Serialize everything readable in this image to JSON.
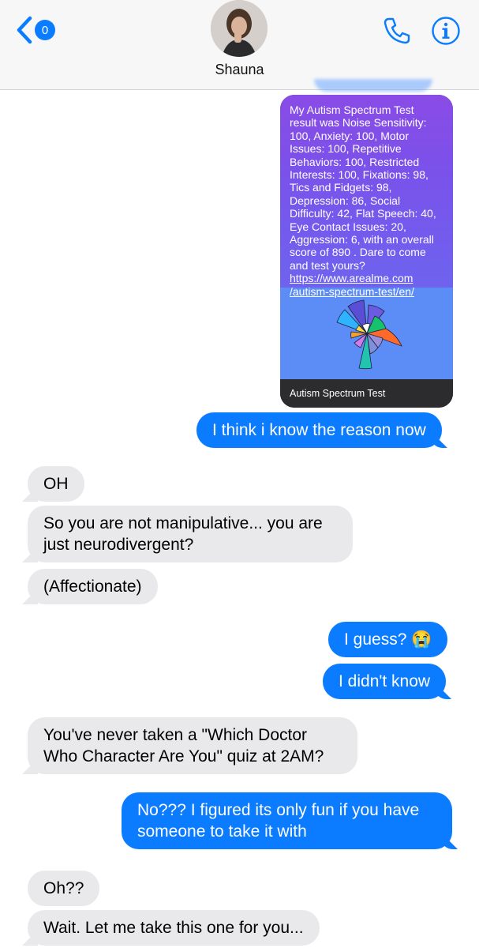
{
  "header": {
    "back_badge": "0",
    "contact_name": "Shauna"
  },
  "card": {
    "body_text": "My Autism Spectrum Test result was Noise Sensitivity: 100, Anxiety: 100, Motor Issues: 100, Repetitive Behaviors: 100, Restricted Interests: 100, Fixations: 98, Tics and Fidgets: 98, Depression: 86, Social Difficulty: 42, Flat Speech: 40, Eye Contact Issues: 20, Aggression: 6, with an overall score of 890 . Dare to come and test yours?",
    "link_line1": "https://www.arealme.com",
    "link_line2": "/autism-spectrum-test/en/",
    "caption": "Autism Spectrum Test"
  },
  "messages": [
    {
      "from": "me",
      "text": "I think i know the reason now"
    },
    {
      "from": "them",
      "text": "OH"
    },
    {
      "from": "them",
      "text_line1": "So you are not manipulative... you are",
      "text_line2": "just neurodivergent?"
    },
    {
      "from": "them",
      "text": "(Affectionate)"
    },
    {
      "from": "me",
      "text": "I guess? 😭"
    },
    {
      "from": "me",
      "text": "I didn't know"
    },
    {
      "from": "them",
      "text_line1": "You've never taken a \"Which Doctor",
      "text_line2": "Who Character Are You\" quiz at 2AM?"
    },
    {
      "from": "me",
      "text_line1": "No??? I figured its only fun if you have",
      "text_line2": "someone to take it with"
    },
    {
      "from": "them",
      "text": "Oh??"
    },
    {
      "from": "them",
      "text": "Wait. Let me take this one for you..."
    }
  ],
  "colors": {
    "outgoing_bubble": "#0b7cff",
    "incoming_bubble": "#e9e9eb",
    "accent": "#0a7cff"
  }
}
